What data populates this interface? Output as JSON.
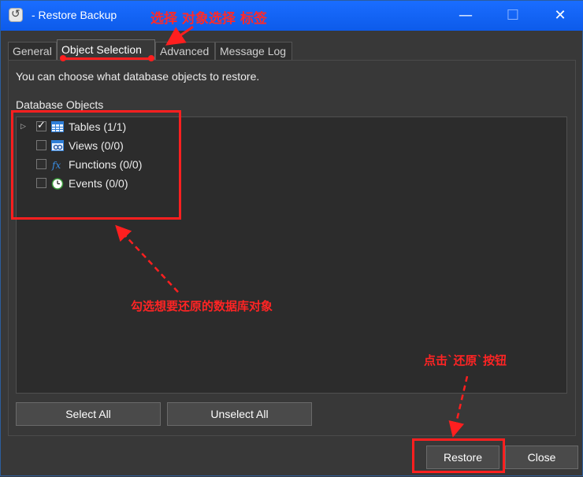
{
  "window": {
    "title": "- Restore Backup",
    "title_annotation": "选择 对象选择 标签"
  },
  "titlebar_buttons": {
    "minimize": "—",
    "maximize": "☐",
    "close": "✕"
  },
  "tabs": [
    {
      "label": "General"
    },
    {
      "label": "Object Selection"
    },
    {
      "label": "Advanced"
    },
    {
      "label": "Message Log"
    }
  ],
  "panel": {
    "info_text": "You can choose what database objects to restore.",
    "section_label": "Database Objects"
  },
  "tree": {
    "items": [
      {
        "label": "Tables (1/1)",
        "checked": true,
        "icon": "table-icon",
        "has_expander": true
      },
      {
        "label": "Views (0/0)",
        "checked": false,
        "icon": "view-icon",
        "has_expander": false
      },
      {
        "label": "Functions (0/0)",
        "checked": false,
        "icon": "function-icon",
        "has_expander": false
      },
      {
        "label": "Events (0/0)",
        "checked": false,
        "icon": "event-icon",
        "has_expander": false
      }
    ]
  },
  "buttons": {
    "select_all": "Select All",
    "unselect_all": "Unselect All",
    "restore": "Restore",
    "close": "Close"
  },
  "annotations": {
    "tree_hint": "勾选想要还原的数据库对象",
    "restore_hint": "点击`还原`按钮"
  },
  "colors": {
    "titlebar": "#0f64ff",
    "annotation": "#ff2424",
    "background": "#383838"
  }
}
